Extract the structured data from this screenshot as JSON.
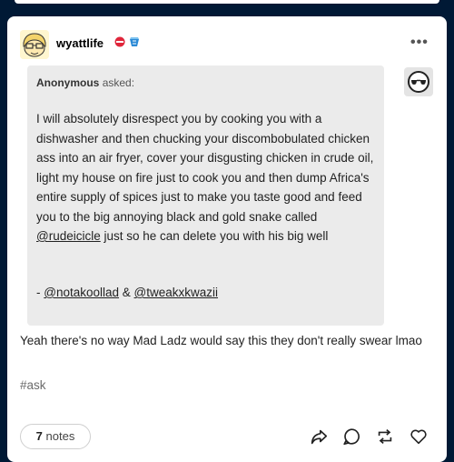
{
  "post": {
    "blog_name": "wyattlife",
    "menu_label": "•••",
    "ask": {
      "asker": "Anonymous",
      "asked_label": "asked:",
      "body_part1": "I will absolutely disrespect you by cooking you with a dishwasher and then chucking your discombobulated chicken ass into an air fryer, cover your disgusting chicken in crude oil, light my house on fire just to cook you and then dump Africa's entire supply of spices just to make you taste good and feed you to the big annoying black and gold snake called ",
      "mention1": "@rudeicicle",
      "body_part2": " just so he can delete you with his big well",
      "sign_prefix": "- ",
      "mention2": "@notakoollad",
      "sign_amp": " & ",
      "mention3": "@tweakxkwazii"
    },
    "reply": "Yeah there's no way Mad Ladz would say this they don't really swear lmao",
    "tags": [
      "#ask"
    ],
    "notes_count": "7",
    "notes_label": "notes"
  },
  "icons": {
    "share": "share-icon",
    "reply": "reply-icon",
    "reblog": "reblog-icon",
    "like": "heart-icon"
  },
  "colors": {
    "background": "#001935",
    "ask_box": "#ebebeb",
    "badge_red": "#e0263b",
    "badge_blue": "#2b8ad6"
  }
}
